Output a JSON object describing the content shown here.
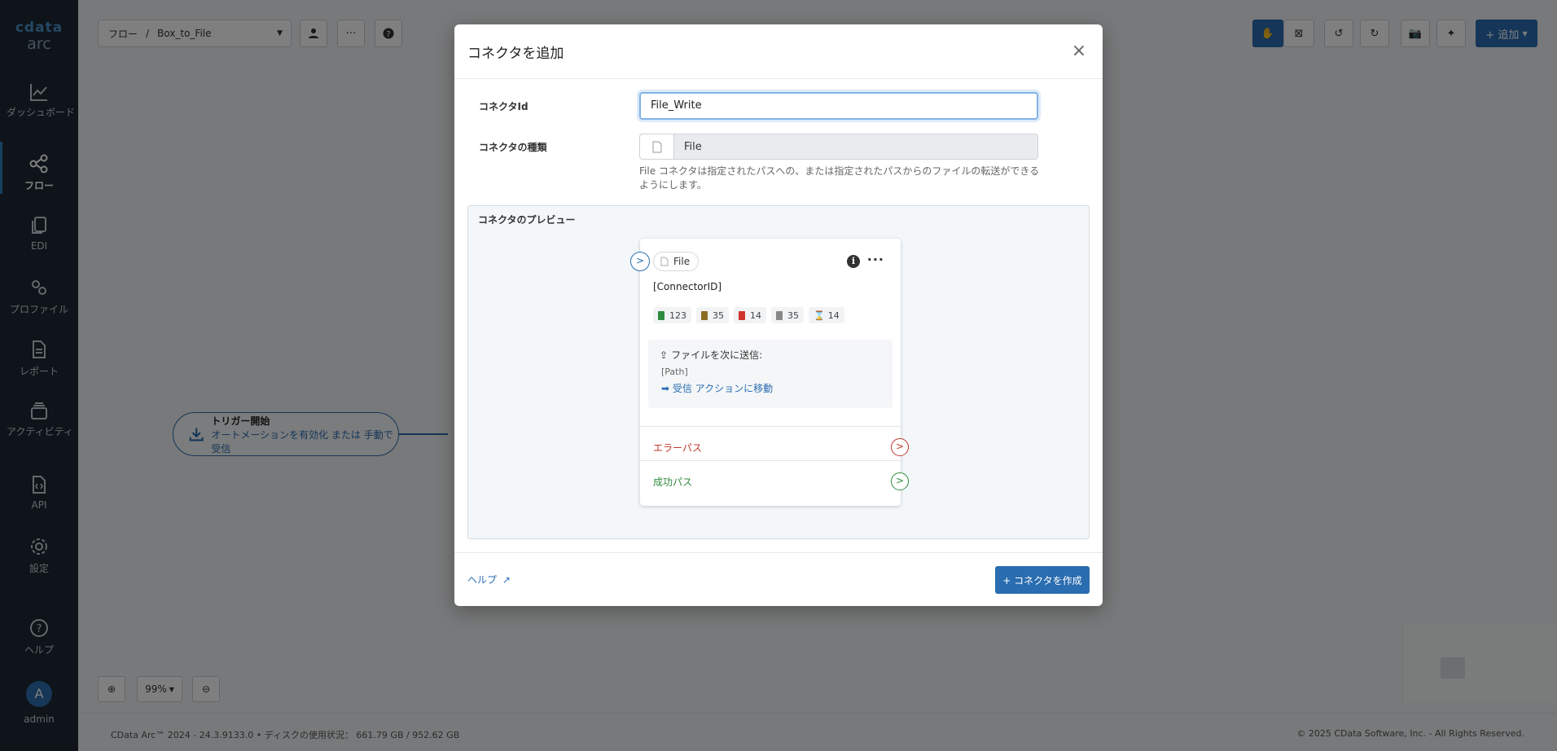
{
  "app": {
    "brand": "cdata",
    "sub": "arc"
  },
  "sidebar": {
    "items": [
      {
        "label": "ダッシュボード"
      },
      {
        "label": "フロー"
      },
      {
        "label": "EDI"
      },
      {
        "label": "プロファイル"
      },
      {
        "label": "レポート"
      },
      {
        "label": "アクティビティ"
      },
      {
        "label": "API"
      },
      {
        "label": "設定"
      },
      {
        "label": "ヘルプ"
      }
    ],
    "user_initial": "A",
    "user_name": "admin"
  },
  "toolbar": {
    "breadcrumb_root": "フロー",
    "breadcrumb_sep": "/",
    "breadcrumb_flow": "Box_to_File",
    "more": "···",
    "add_label": "+ 追加"
  },
  "canvas": {
    "trigger_title": "トリガー開始",
    "trigger_sub": "オートメーションを有効化 または 手動で受信",
    "zoom_level": "99%"
  },
  "footer": {
    "left": "CData Arc™ 2024 - 24.3.9133.0 • ディスクの使用状況： 661.79 GB / 952.62 GB",
    "right": "© 2025 CData Software, Inc. - All Rights Reserved."
  },
  "modal": {
    "title": "コネクタを追加",
    "close": "×",
    "connector_id_label": "コネクタId",
    "connector_id_value": "File_Write",
    "connector_type_label": "コネクタの種類",
    "connector_type_value": "File",
    "description": "File コネクタは指定されたパスへの、または指定されたパスからのファイルの転送ができるようにします。",
    "preview_title": "コネクタのプレビュー",
    "help_link": "ヘルプ",
    "create_button": "+ コネクタを作成"
  },
  "preview_card": {
    "chip": "File",
    "connector_id": "[ConnectorID]",
    "stats": [
      {
        "value": "123",
        "color": "#2e8b3d"
      },
      {
        "value": "35",
        "color": "#8a6d1f"
      },
      {
        "value": "14",
        "color": "#d0342c"
      },
      {
        "value": "35",
        "color": "#888888"
      },
      {
        "value": "14",
        "color": "#666666"
      }
    ],
    "send_title": "ファイルを次に送信:",
    "send_path": "[Path]",
    "send_link": "➡ 受信 アクションに移動",
    "error_path": "エラーパス",
    "success_path": "成功パス"
  }
}
